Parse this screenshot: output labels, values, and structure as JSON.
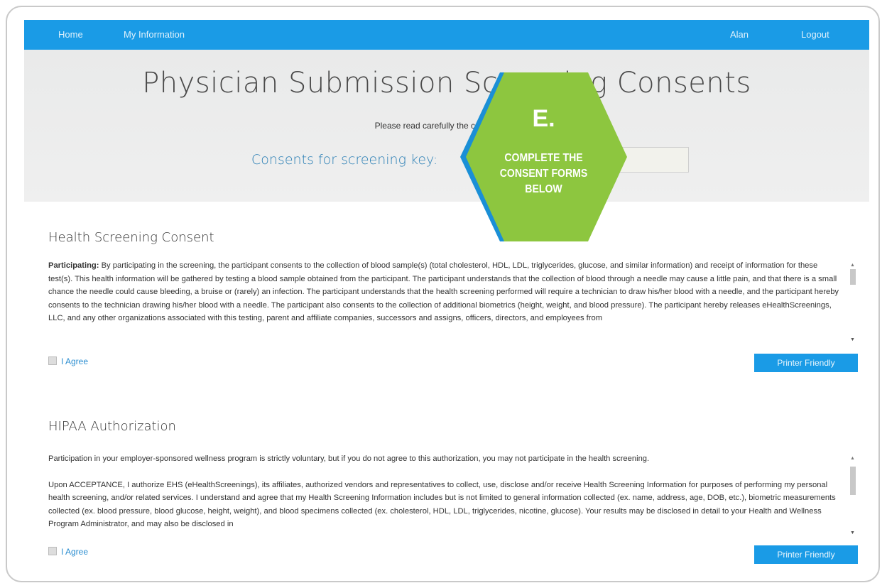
{
  "nav": {
    "home": "Home",
    "my_information": "My Information",
    "user": "Alan",
    "logout": "Logout"
  },
  "hero": {
    "title": "Physician Submission Screening Consents",
    "subtitle": "Please read carefully the consents bel",
    "key_label": "Consents for screening key:"
  },
  "callout": {
    "letter": "E.",
    "line1": "COMPLETE THE",
    "line2": "CONSENT FORMS",
    "line3": "BELOW"
  },
  "health_consent": {
    "title": "Health Screening Consent",
    "lead": "Participating:",
    "body": "By participating in the screening, the participant consents to the collection of blood sample(s) (total cholesterol, HDL, LDL, triglycerides, glucose, and similar information) and receipt of information for these test(s). This health information will be gathered by testing a blood sample obtained from the participant. The participant understands that the collection of blood through a needle may cause a little pain, and that there is a small chance the needle could cause bleeding, a bruise or (rarely) an infection. The participant understands that the health screening performed will require a technician to draw his/her blood with a needle, and the participant hereby consents to the technician drawing his/her blood with a needle. The participant also consents to the collection of additional biometrics (height, weight, and blood pressure). The participant hereby releases eHealthScreenings, LLC, and any other organizations associated with this testing, parent and affiliate companies, successors and assigns, officers, directors, and employees from",
    "agree_label": "I Agree",
    "printer_label": "Printer Friendly"
  },
  "hipaa": {
    "title": "HIPAA Authorization",
    "para1": "Participation in your employer-sponsored wellness program is strictly voluntary, but if you do not agree to this authorization, you may not participate in the health screening.",
    "para2": "Upon ACCEPTANCE, I authorize EHS (eHealthScreenings), its affiliates, authorized vendors and representatives to collect, use, disclose and/or receive Health Screening Information for purposes of performing my personal health screening, and/or related services. I understand and agree that my Health Screening Information includes but is not limited to general information collected (ex. name, address, age, DOB, etc.), biometric measurements collected (ex. blood pressure, blood glucose, height, weight), and blood specimens collected (ex. cholesterol, HDL, LDL, triglycerides, nicotine, glucose). Your results may be disclosed in detail to your Health and Wellness Program Administrator, and may also be disclosed in",
    "agree_label": "I Agree",
    "printer_label": "Printer Friendly"
  },
  "colors": {
    "nav_blue": "#1a9be6",
    "badge_green": "#8dc63f",
    "badge_edge_blue": "#1a8fd6",
    "key_label_blue": "#2a7fb5"
  }
}
